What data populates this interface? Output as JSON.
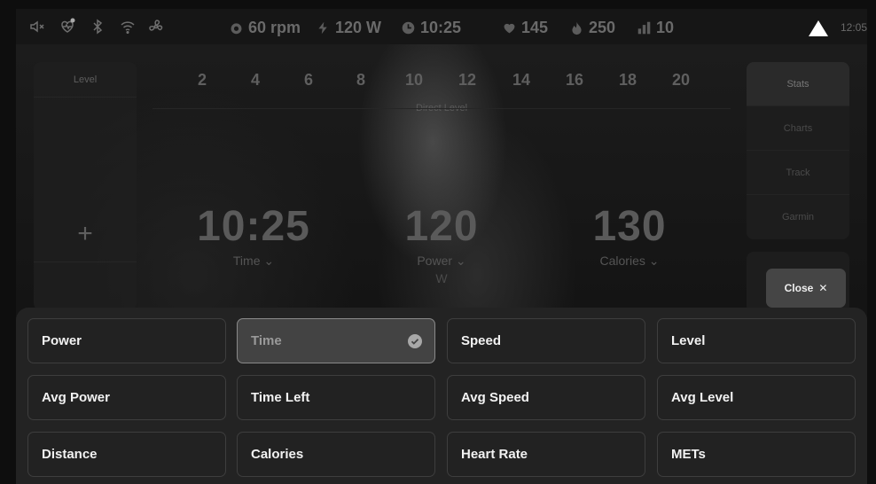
{
  "status_bar": {
    "icons": [
      "mute-icon",
      "heart-monitor-icon",
      "bluetooth-icon",
      "wifi-icon",
      "fan-icon"
    ],
    "metrics": [
      {
        "icon": "cadence-icon",
        "value": "60 rpm"
      },
      {
        "icon": "power-bolt-icon",
        "value": "120 W"
      },
      {
        "icon": "clock-icon",
        "value": "10:25"
      },
      {
        "icon": "heart-icon",
        "value": "145"
      },
      {
        "icon": "flame-icon",
        "value": "250"
      },
      {
        "icon": "level-bars-icon",
        "value": "10"
      }
    ],
    "time": "12:05"
  },
  "level_panel": {
    "title": "Level",
    "plus": "+"
  },
  "direct_level": {
    "numbers": [
      "2",
      "4",
      "6",
      "8",
      "10",
      "12",
      "14",
      "16",
      "18",
      "20"
    ],
    "label": "Direct Level"
  },
  "right_tabs": [
    "Stats",
    "Charts",
    "Track",
    "Garmin"
  ],
  "close_button": {
    "label": "Close",
    "icon": "close-icon"
  },
  "big_metrics": [
    {
      "value": "10:25",
      "label": "Time",
      "unit": ""
    },
    {
      "value": "120",
      "label": "Power",
      "unit": "W"
    },
    {
      "value": "130",
      "label": "Calories",
      "unit": ""
    }
  ],
  "options": [
    {
      "label": "Power",
      "selected": false
    },
    {
      "label": "Time",
      "selected": true
    },
    {
      "label": "Speed",
      "selected": false
    },
    {
      "label": "Level",
      "selected": false
    },
    {
      "label": "Avg Power",
      "selected": false
    },
    {
      "label": "Time Left",
      "selected": false
    },
    {
      "label": "Avg Speed",
      "selected": false
    },
    {
      "label": "Avg Level",
      "selected": false
    },
    {
      "label": "Distance",
      "selected": false
    },
    {
      "label": "Calories",
      "selected": false
    },
    {
      "label": "Heart Rate",
      "selected": false
    },
    {
      "label": "METs",
      "selected": false
    }
  ],
  "colors": {
    "warning": "#ffffff",
    "selected_bg": "#434343"
  }
}
